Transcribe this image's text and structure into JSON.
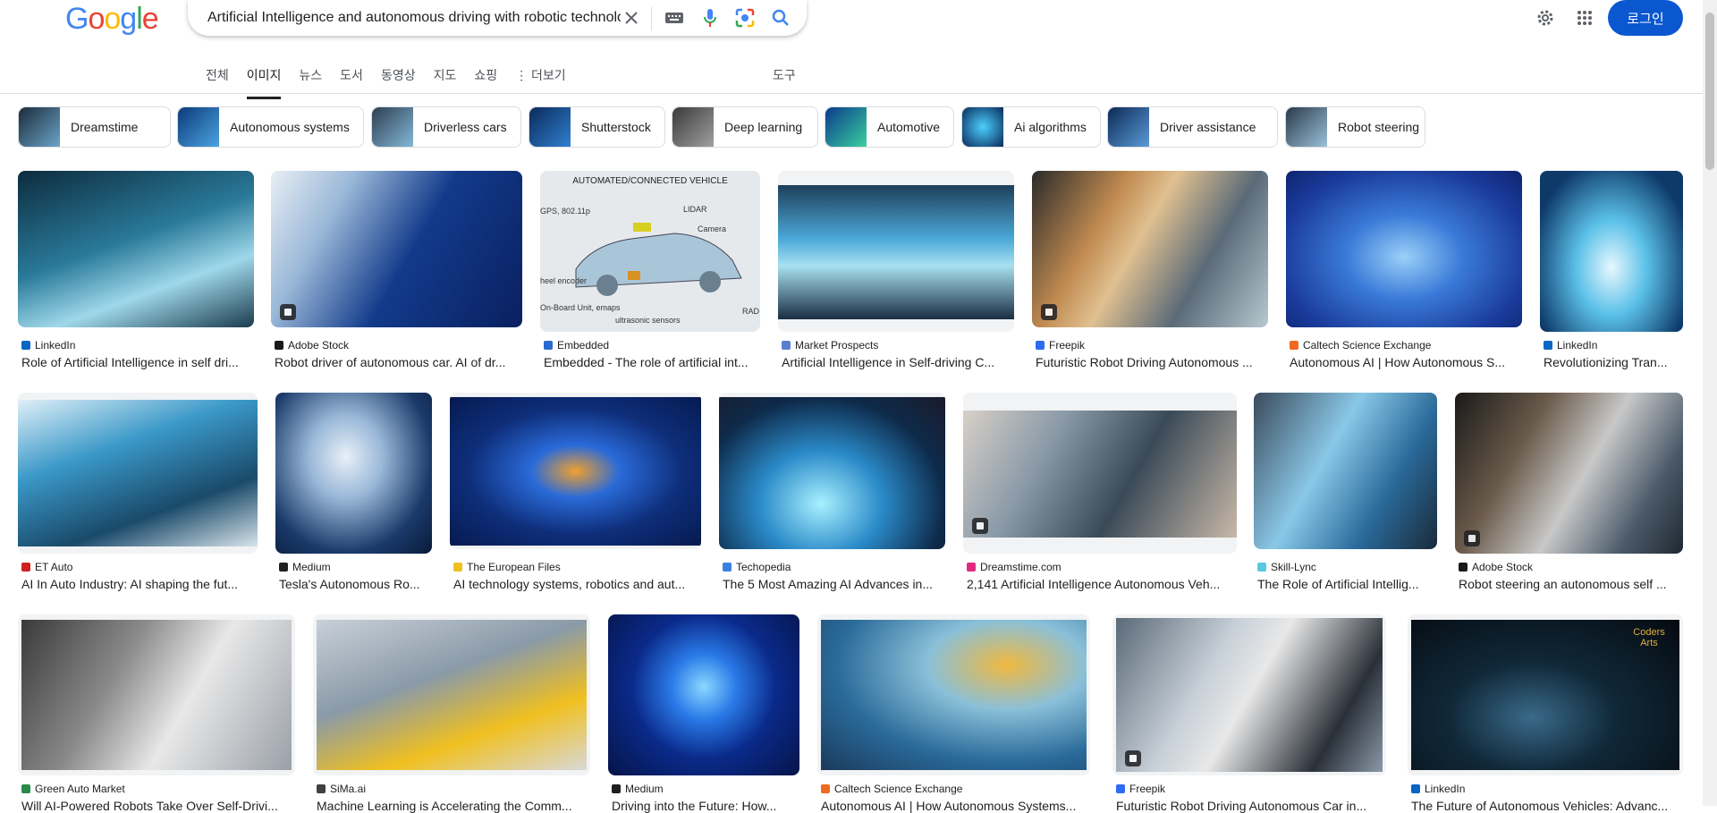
{
  "logo": {
    "g1": "G",
    "o1": "o",
    "o2": "o",
    "g2": "g",
    "l": "l",
    "e": "e"
  },
  "search": {
    "value": "Artificial Intelligence and autonomous driving with robotic technology",
    "aria": "검색"
  },
  "header": {
    "login_label": "로그인"
  },
  "tabs": [
    {
      "label": "전체"
    },
    {
      "label": "이미지"
    },
    {
      "label": "뉴스"
    },
    {
      "label": "도서"
    },
    {
      "label": "동영상"
    },
    {
      "label": "지도"
    },
    {
      "label": "쇼핑"
    },
    {
      "label": "⋮ 더보기"
    }
  ],
  "tools_label": "도구",
  "chips": [
    {
      "label": "Dreamstime"
    },
    {
      "label": "Autonomous systems"
    },
    {
      "label": "Driverless cars"
    },
    {
      "label": "Shutterstock"
    },
    {
      "label": "Deep learning"
    },
    {
      "label": "Automotive"
    },
    {
      "label": "Ai algorithms"
    },
    {
      "label": "Driver assistance"
    },
    {
      "label": "Robot steering"
    }
  ],
  "results": [
    {
      "source": "LinkedIn",
      "title": "Role of Artificial Intelligence in self dri..."
    },
    {
      "source": "Adobe Stock",
      "title": "Robot driver of autonomous car. AI of dr..."
    },
    {
      "source": "Embedded",
      "title": "Embedded - The role of artificial int..."
    },
    {
      "source": "Market Prospects",
      "title": "Artificial Intelligence in Self-driving C..."
    },
    {
      "source": "Freepik",
      "title": "Futuristic Robot Driving Autonomous ..."
    },
    {
      "source": "Caltech Science Exchange",
      "title": "Autonomous AI | How Autonomous S..."
    },
    {
      "source": "LinkedIn",
      "title": "Revolutionizing Tran..."
    },
    {
      "source": "ET Auto",
      "title": "AI In Auto Industry: AI shaping the fut..."
    },
    {
      "source": "Medium",
      "title": "Tesla's Autonomous Ro..."
    },
    {
      "source": "The European Files",
      "title": "AI technology systems, robotics and aut..."
    },
    {
      "source": "Techopedia",
      "title": "The 5 Most Amazing AI Advances in..."
    },
    {
      "source": "Dreamstime.com",
      "title": "2,141 Artificial Intelligence Autonomous Veh..."
    },
    {
      "source": "Skill-Lync",
      "title": "The Role of Artificial Intellig..."
    },
    {
      "source": "Adobe Stock",
      "title": "Robot steering an autonomous self ..."
    },
    {
      "source": "Green Auto Market",
      "title": "Will AI-Powered Robots Take Over Self-Drivi..."
    },
    {
      "source": "SiMa.ai",
      "title": "Machine Learning is Accelerating the Comm..."
    },
    {
      "source": "Medium",
      "title": "Driving into the Future: How..."
    },
    {
      "source": "Caltech Science Exchange",
      "title": "Autonomous AI | How Autonomous Systems..."
    },
    {
      "source": "Freepik",
      "title": "Futuristic Robot Driving Autonomous Car in..."
    },
    {
      "source": "LinkedIn",
      "title": "The Future of Autonomous Vehicles: Advanc..."
    }
  ],
  "embedded_diagram": {
    "heading": "AUTOMATED/CONNECTED VEHICLE",
    "labels": [
      "GPS, 802.11p",
      "LIDAR",
      "Camera",
      "heel encoder",
      "On-Board Unit, emaps",
      "ultrasonic sensors",
      "RAD"
    ]
  },
  "coders_arts": "Coders Arts",
  "colors": {
    "accent": "#0b57d0",
    "text": "#202124",
    "muted": "#4d5156"
  }
}
